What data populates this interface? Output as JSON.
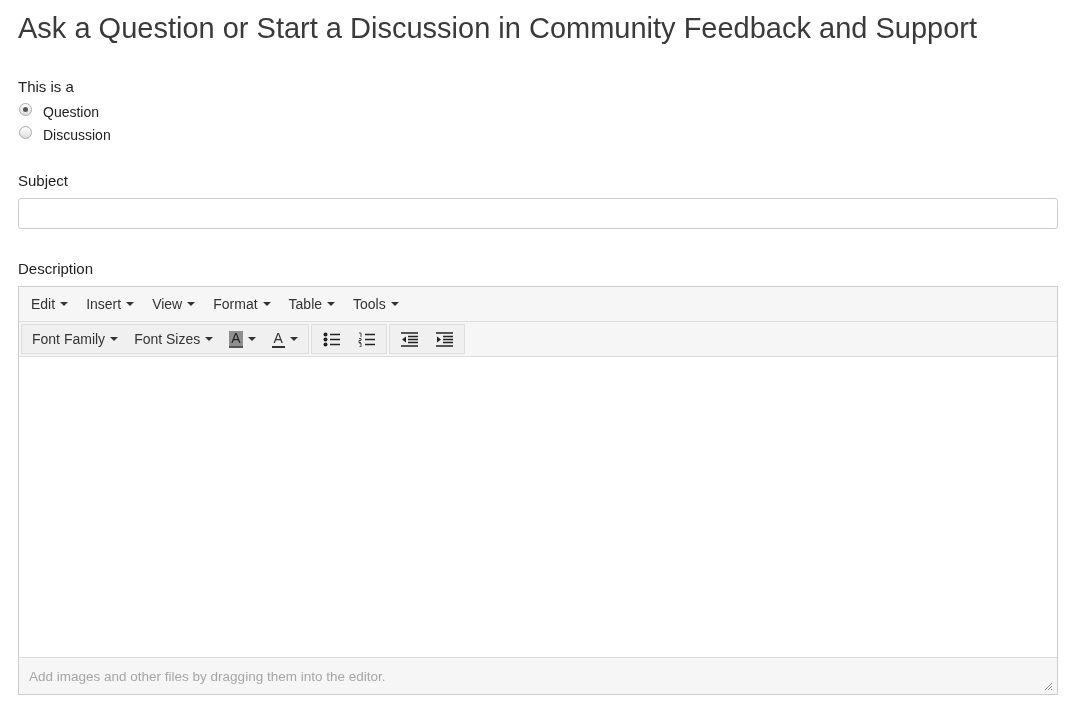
{
  "page_title": "Ask a Question or Start a Discussion in Community Feedback and Support",
  "post_type": {
    "label": "This is a",
    "options": [
      {
        "label": "Question",
        "selected": true
      },
      {
        "label": "Discussion",
        "selected": false
      }
    ]
  },
  "subject": {
    "label": "Subject"
  },
  "description": {
    "label": "Description",
    "menu_bar": [
      "Edit",
      "Insert",
      "View",
      "Format",
      "Table",
      "Tools"
    ],
    "toolbar_groups": [
      [
        {
          "kind": "dropdown",
          "label": "Font Family"
        },
        {
          "kind": "dropdown",
          "label": "Font Sizes"
        },
        {
          "kind": "background-color",
          "label": "A"
        },
        {
          "kind": "text-color",
          "label": "A"
        }
      ],
      [
        {
          "kind": "bullet-list"
        },
        {
          "kind": "numbered-list"
        }
      ],
      [
        {
          "kind": "outdent"
        },
        {
          "kind": "indent"
        }
      ]
    ],
    "status_text": "Add images and other files by dragging them into the editor."
  }
}
